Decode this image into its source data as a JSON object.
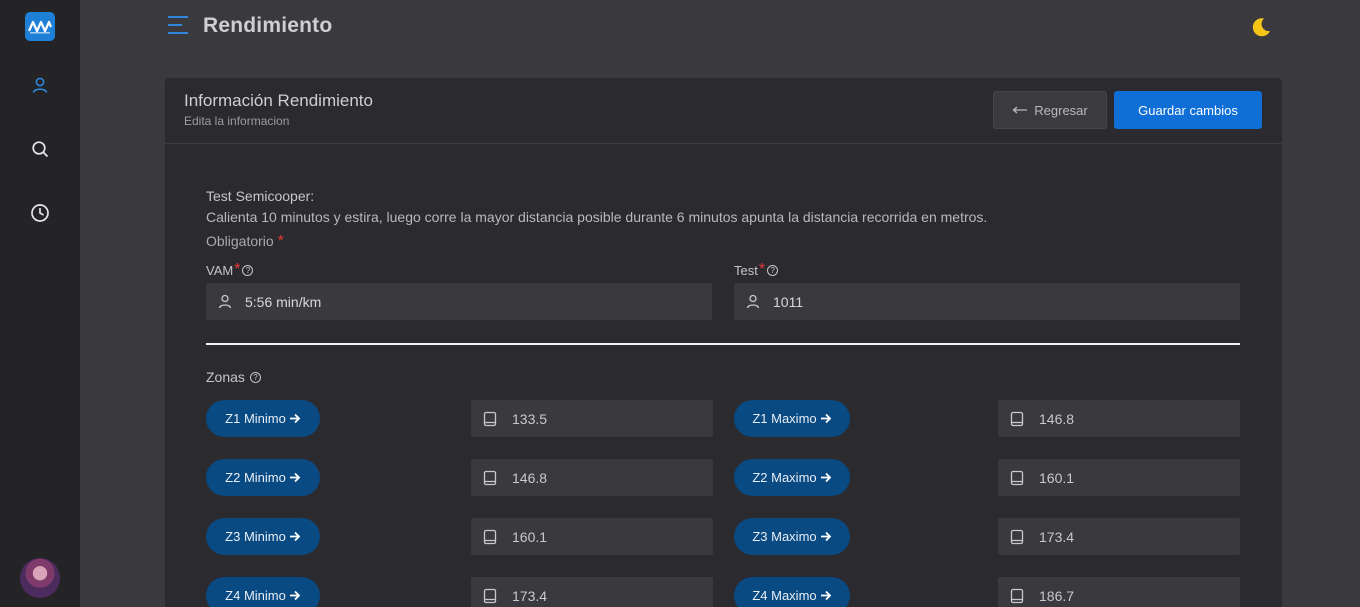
{
  "header": {
    "title": "Rendimiento"
  },
  "sidebar": {
    "icons": [
      "user-icon",
      "search-icon",
      "clock-icon"
    ],
    "accent": "#1e7fd6"
  },
  "card": {
    "title": "Información Rendimiento",
    "subtitle": "Edita la informacion",
    "back_label": "Regresar",
    "save_label": "Guardar cambios"
  },
  "test": {
    "title": "Test Semicooper:",
    "description": "Calienta 10 minutos y estira, luego corre la mayor distancia posible durante 6 minutos apunta la distancia recorrida en metros.",
    "required_label": "Obligatorio"
  },
  "fields": {
    "vam": {
      "label": "VAM",
      "value": "5:56 min/km"
    },
    "test": {
      "label": "Test",
      "value": "1011"
    }
  },
  "zonas": {
    "label": "Zonas",
    "rows": [
      {
        "min_label": "Z1 Minimo",
        "min_value": "133.5",
        "max_label": "Z1 Maximo",
        "max_value": "146.8"
      },
      {
        "min_label": "Z2 Minimo",
        "min_value": "146.8",
        "max_label": "Z2 Maximo",
        "max_value": "160.1"
      },
      {
        "min_label": "Z3 Minimo",
        "min_value": "160.1",
        "max_label": "Z3 Maximo",
        "max_value": "173.4"
      },
      {
        "min_label": "Z4 Minimo",
        "min_value": "173.4",
        "max_label": "Z4 Maximo",
        "max_value": "186.7"
      }
    ]
  },
  "colors": {
    "primary_button": "#0f6fd6",
    "zone_pill": "#0a4a83",
    "required_star": "#e53935",
    "moon": "#f5c518"
  }
}
